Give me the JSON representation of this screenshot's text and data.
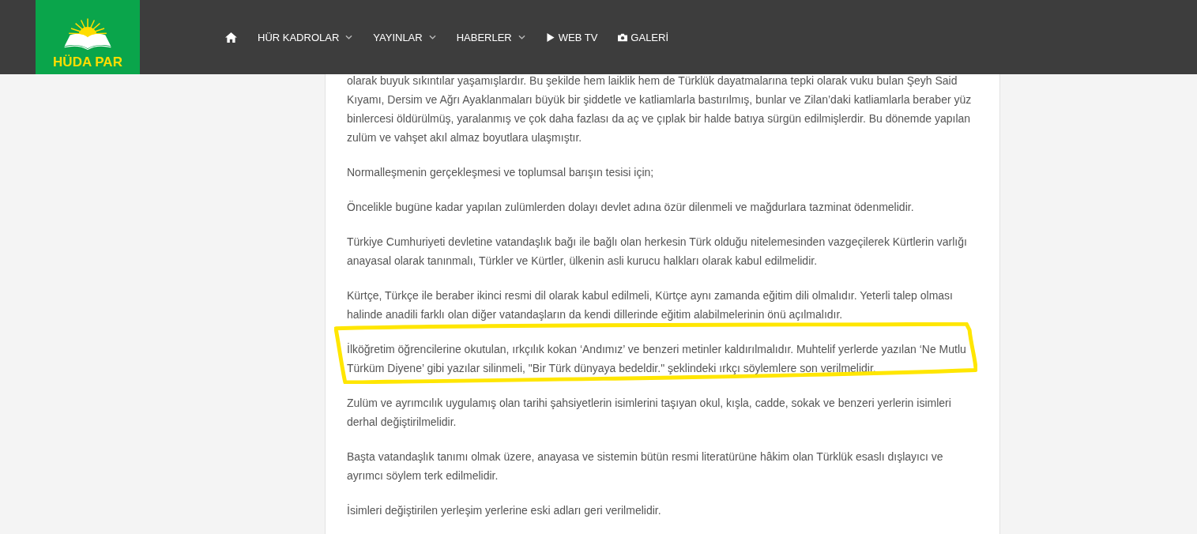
{
  "header": {
    "logo_text": "HÜDA PAR",
    "nav": [
      {
        "kind": "home"
      },
      {
        "kind": "dropdown",
        "label": "HÜR KADROLAR"
      },
      {
        "kind": "dropdown",
        "label": "YAYINLAR"
      },
      {
        "kind": "dropdown",
        "label": "HABERLER"
      },
      {
        "kind": "video",
        "label": "WEB TV"
      },
      {
        "kind": "photo",
        "label": "GALERİ"
      }
    ]
  },
  "article": {
    "paragraphs": [
      {
        "text": "olarak buyuk sıkıntılar yaşamışlardır. Bu şekilde hem laiklik hem de Türklük dayatmalarına tepki olarak vuku bulan Şeyh Said Kıyamı, Dersim ve Ağrı Ayaklanmaları büyük bir şiddetle ve katliamlarla bastırılmış, bunlar ve Zilan’daki katliamlarla beraber yüz binlercesi öldürülmüş, yaralanmış ve çok daha fazlası da aç ve çıplak bir halde batıya sürgün edilmişlerdir. Bu dönemde yapılan zulüm ve vahşet akıl almaz boyutlara ulaşmıştır.",
        "highlighted": false
      },
      {
        "text": "Normalleşmenin gerçekleşmesi ve toplumsal barışın tesisi için;",
        "highlighted": false
      },
      {
        "text": "Öncelikle bugüne kadar yapılan zulümlerden dolayı devlet adına özür dilenmeli ve mağdurlara tazminat ödenmelidir.",
        "highlighted": false
      },
      {
        "text": "Türkiye Cumhuriyeti devletine vatandaşlık bağı ile bağlı olan herkesin Türk olduğu nitelemesinden vazgeçilerek Kürtlerin varlığı anayasal olarak tanınmalı, Türkler ve Kürtler, ülkenin asli kurucu halkları olarak kabul edilmelidir.",
        "highlighted": false
      },
      {
        "text": "Kürtçe, Türkçe ile beraber ikinci resmi dil olarak kabul edilmeli, Kürtçe aynı zamanda eğitim dili olmalıdır. Yeterli talep olması halinde anadili farklı olan diğer vatandaşların da kendi dillerinde eğitim alabilmelerinin önü açılmalıdır.",
        "highlighted": false
      },
      {
        "text": "İlköğretim öğrencilerine okutulan, ırkçılık kokan ‘Andımız’ ve benzeri metinler kaldırılmalıdır. Muhtelif yerlerde yazılan ‘Ne Mutlu Türküm Diyene’ gibi yazılar silinmeli, \"Bir Türk dünyaya bedeldir.\" şeklindeki ırkçı söylemlere son verilmelidir.",
        "highlighted": true
      },
      {
        "text": "Zulüm ve ayrımcılık uygulamış olan tarihi şahsiyetlerin isimlerini taşıyan okul, kışla, cadde, sokak ve benzeri yerlerin isimleri derhal değiştirilmelidir.",
        "highlighted": false
      },
      {
        "text": "Başta vatandaşlık tanımı olmak üzere, anayasa ve sistemin bütün resmi literatürüne hâkim olan Türklük esaslı dışlayıcı ve ayrımcı söylem terk edilmelidir.",
        "highlighted": false
      },
      {
        "text": "İsimleri değiştirilen yerleşim yerlerine eski adları geri verilmelidir.",
        "highlighted": false
      }
    ]
  }
}
